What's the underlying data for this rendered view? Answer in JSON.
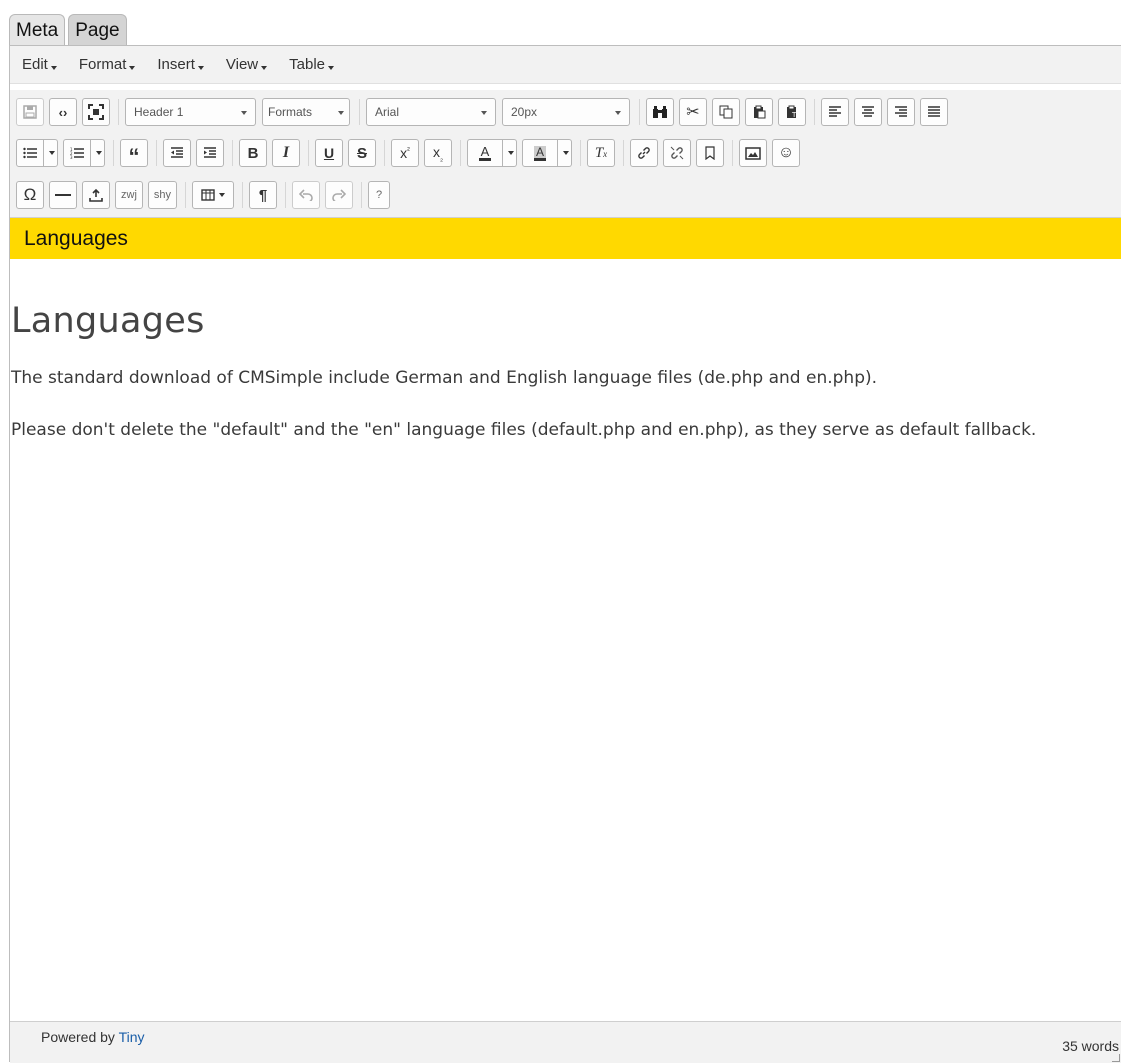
{
  "tabs": [
    {
      "label": "Meta"
    },
    {
      "label": "Page"
    }
  ],
  "menubar": {
    "items": [
      "Edit",
      "Format",
      "Insert",
      "View",
      "Table"
    ]
  },
  "toolbar": {
    "block_format": "Header 1",
    "formats_label": "Formats",
    "font_family": "Arial",
    "font_size": "20px",
    "zwj_label": "zwj",
    "shy_label": "shy",
    "help_label": "?"
  },
  "page_header": "Languages",
  "content": {
    "heading": "Languages",
    "paragraphs": [
      "The standard download of CMSimple include German and English language files (de.php and en.php).",
      "Please don't delete the \"default\" and the \"en\" language files (default.php and en.php), as they serve as default fallback."
    ]
  },
  "statusbar": {
    "powered_prefix": "Powered by ",
    "powered_link": "Tiny",
    "word_count": "35 words"
  },
  "colors": {
    "header_bg": "#ffd900",
    "toolbar_bg": "#f2f2f2",
    "link": "#1a5ea8"
  }
}
